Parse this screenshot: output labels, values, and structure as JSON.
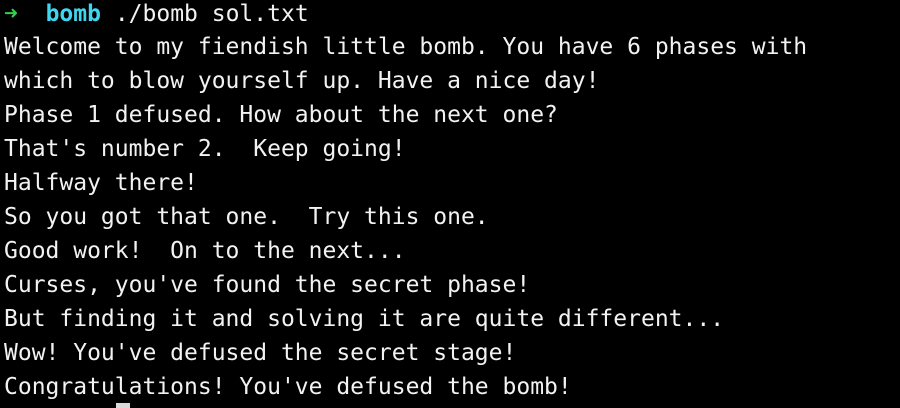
{
  "prompt": {
    "arrow": "➜",
    "directory": "bomb",
    "command": "./bomb sol.txt"
  },
  "output": [
    "Welcome to my fiendish little bomb. You have 6 phases with",
    "which to blow yourself up. Have a nice day!",
    "Phase 1 defused. How about the next one?",
    "That's number 2.  Keep going!",
    "Halfway there!",
    "So you got that one.  Try this one.",
    "Good work!  On to the next...",
    "Curses, you've found the secret phase!",
    "But finding it and solving it are quite different...",
    "Wow! You've defused the secret stage!",
    "Congratulations! You've defused the bomb!"
  ],
  "colors": {
    "background": "#000000",
    "text": "#f2f2f2",
    "arrow": "#34d14a",
    "directory": "#3fd7f0"
  }
}
